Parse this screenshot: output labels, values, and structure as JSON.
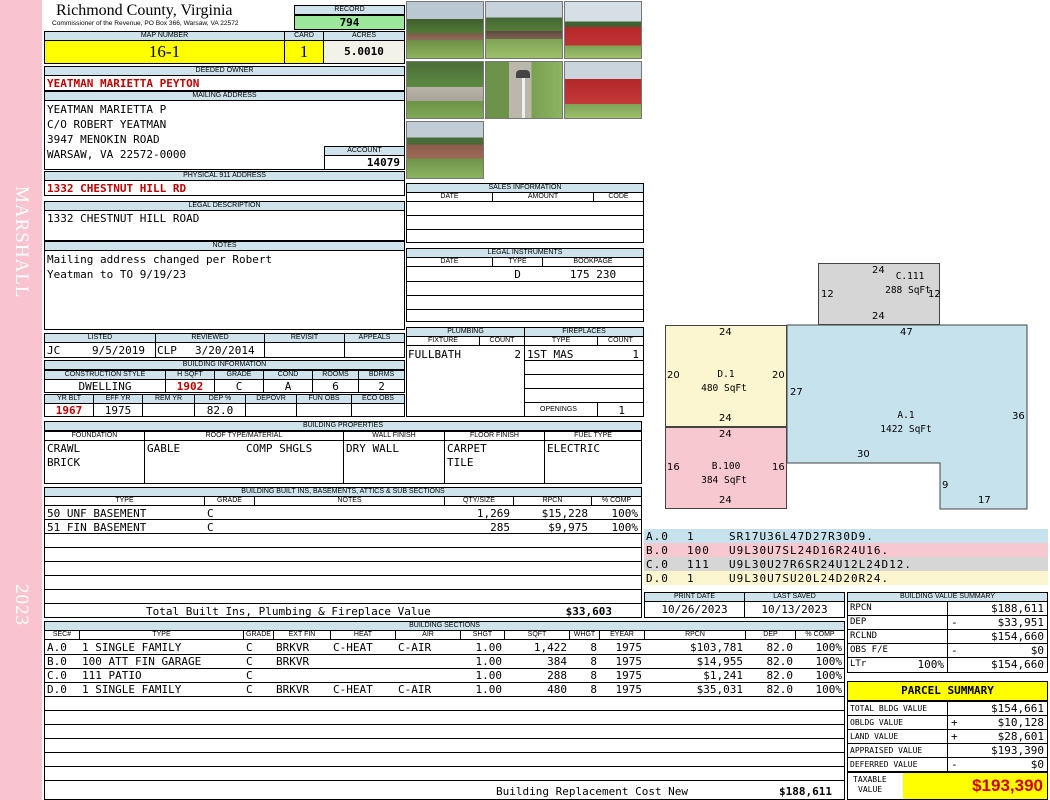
{
  "side": {
    "name": "MARSHALL",
    "year": "2023"
  },
  "header": {
    "county": "Richmond County, Virginia",
    "subtitle": "Commissioner of the Revenue, PO Box 366, Warsaw, VA 22572",
    "record_label": "RECORD",
    "record": "794",
    "map_label": "MAP NUMBER",
    "map": "16-1",
    "card_label": "CARD",
    "card": "1",
    "acres_label": "ACRES",
    "acres": "5.0010"
  },
  "owner": {
    "label": "DEEDED OWNER",
    "name": "YEATMAN MARIETTA PEYTON"
  },
  "mailing": {
    "label": "MAILING ADDRESS",
    "line1": "YEATMAN MARIETTA P",
    "line2": "C/O ROBERT YEATMAN",
    "line3": "3947 MENOKIN ROAD",
    "line4": "WARSAW, VA 22572-0000"
  },
  "account": {
    "label": "ACCOUNT",
    "value": "14079"
  },
  "physical": {
    "label": "PHYSICAL 911 ADDRESS",
    "value": "1332 CHESTNUT HILL RD"
  },
  "legal": {
    "label": "LEGAL DESCRIPTION",
    "value": "1332 CHESTNUT HILL ROAD"
  },
  "notes": {
    "label": "NOTES",
    "line1": "Mailing address changed per Robert",
    "line2": "Yeatman to TO 9/19/23"
  },
  "listed": {
    "listed_label": "LISTED",
    "reviewed_label": "REVIEWED",
    "revisit_label": "REVISIT",
    "appeals_label": "APPEALS",
    "listed_by": "JC",
    "listed_date": "9/5/2019",
    "reviewed_by": "CLP",
    "reviewed_date": "3/20/2014"
  },
  "building_info": {
    "label": "BUILDING INFORMATION",
    "h_style": "CONSTRUCTION STYLE",
    "h_hsqft": "H SQFT",
    "h_grade": "GRADE",
    "h_cond": "COND",
    "h_rooms": "ROOMS",
    "h_bdrms": "BDRMS",
    "style": "DWELLING",
    "hsqft": "1902",
    "grade": "C",
    "cond": "A",
    "rooms": "6",
    "bdrms": "2",
    "h_yrblt": "YR BLT",
    "h_effyr": "EFF YR",
    "h_remyr": "REM YR",
    "h_dep": "DEP %",
    "h_depovr": "DEPOVR",
    "h_funobs": "FUN OBS",
    "h_ecoobs": "ECO OBS",
    "yrblt": "1967",
    "effyr": "1975",
    "dep": "82.0"
  },
  "sales": {
    "label": "SALES INFORMATION",
    "h_date": "DATE",
    "h_amount": "AMOUNT",
    "h_code": "CODE"
  },
  "legal_instruments": {
    "label": "LEGAL INSTRUMENTS",
    "h_date": "DATE",
    "h_type": "TYPE",
    "h_book": "BOOKPAGE",
    "type": "D",
    "book": "175 230"
  },
  "plumbing": {
    "label": "PLUMBING",
    "h_fixture": "FIXTURE",
    "h_count": "COUNT",
    "fixture": "FULLBATH",
    "count": "2"
  },
  "fireplaces": {
    "label": "FIREPLACES",
    "h_type": "TYPE",
    "h_count": "COUNT",
    "type": "1ST MAS",
    "count": "1",
    "openings_label": "OPENINGS",
    "openings": "1"
  },
  "properties": {
    "label": "BUILDING PROPERTIES",
    "h_foundation": "FOUNDATION",
    "h_roof": "ROOF TYPE/MATERIAL",
    "h_wall": "WALL FINISH",
    "h_floor": "FLOOR FINISH",
    "h_fuel": "FUEL TYPE",
    "foundation1": "CRAWL",
    "foundation2": "BRICK",
    "roof_type": "GABLE",
    "roof_material": "COMP SHGLS",
    "wall": "DRY WALL",
    "floor1": "CARPET",
    "floor2": "TILE",
    "fuel": "ELECTRIC"
  },
  "builtins": {
    "label": "BUILDING BUILT INS, BASEMENTS, ATTICS & SUB SECTIONS",
    "h_type": "TYPE",
    "h_grade": "GRADE",
    "h_notes": "NOTES",
    "h_qty": "QTY/SIZE",
    "h_rpcn": "RPCN",
    "h_comp": "% COMP",
    "rows": [
      {
        "type": "50 UNF BASEMENT",
        "grade": "C",
        "qty": "1,269",
        "rpcn": "$15,228",
        "comp": "100%"
      },
      {
        "type": "51 FIN BASEMENT",
        "grade": "C",
        "qty": "285",
        "rpcn": "$9,975",
        "comp": "100%"
      }
    ],
    "total_label": "Total Built Ins, Plumbing & Fireplace Value",
    "total": "$33,603"
  },
  "sketch": {
    "c_label": "C.111",
    "c_area": "288 SqFt",
    "c_top": "24",
    "c_left": "12",
    "c_right": "12",
    "c_bottom": "24",
    "d_label": "D.1",
    "d_area": "480 SqFt",
    "d_top": "24",
    "d_left": "20",
    "d_right": "20",
    "d_bottom": "24",
    "a_label": "A.1",
    "a_area": "1422 SqFt",
    "a_top": "47",
    "a_left": "27",
    "a_right": "36",
    "a_step": "30",
    "a_notch": "9",
    "a_bottom": "17",
    "b_label": "B.100",
    "b_area": "384 SqFt",
    "b_top": "24",
    "b_left": "16",
    "b_right": "16",
    "b_bottom": "24"
  },
  "traces": [
    {
      "id": "A.0",
      "code": "1",
      "path": "SR17U36L47D27R30D9.",
      "color": "#c6e2ec"
    },
    {
      "id": "B.0",
      "code": "100",
      "path": "U9L30U7SL24D16R24U16.",
      "color": "#f7c8d0"
    },
    {
      "id": "C.0",
      "code": "111",
      "path": "U9L30U27R6SR24U12L24D12.",
      "color": "#d6d6d6"
    },
    {
      "id": "D.0",
      "code": "1",
      "path": "U9L30U7SU20L24D20R24.",
      "color": "#fbf5d0"
    }
  ],
  "dates": {
    "print_label": "PRINT DATE",
    "print": "10/26/2023",
    "saved_label": "LAST SAVED",
    "saved": "10/13/2023"
  },
  "sections": {
    "label": "BUILDING SECTIONS",
    "h_sec": "SEC#",
    "h_type": "TYPE",
    "h_grade": "GRADE",
    "h_ext": "EXT FIN",
    "h_heat": "HEAT",
    "h_air": "AIR",
    "h_shgt": "SHGT",
    "h_sqft": "SQFT",
    "h_whgt": "WHGT",
    "h_eyear": "EYEAR",
    "h_rpcn": "RPCN",
    "h_dep": "DEP",
    "h_comp": "% COMP",
    "rows": [
      {
        "sec": "A.0",
        "type": "1 SINGLE FAMILY",
        "grade": "C",
        "ext": "BRKVR",
        "heat": "C-HEAT",
        "air": "C-AIR",
        "shgt": "1.00",
        "sqft": "1,422",
        "whgt": "8",
        "eyear": "1975",
        "rpcn": "$103,781",
        "dep": "82.0",
        "comp": "100%"
      },
      {
        "sec": "B.0",
        "type": "100 ATT FIN GARAGE",
        "grade": "C",
        "ext": "BRKVR",
        "heat": "",
        "air": "",
        "shgt": "1.00",
        "sqft": "384",
        "whgt": "8",
        "eyear": "1975",
        "rpcn": "$14,955",
        "dep": "82.0",
        "comp": "100%"
      },
      {
        "sec": "C.0",
        "type": "111 PATIO",
        "grade": "C",
        "ext": "",
        "heat": "",
        "air": "",
        "shgt": "1.00",
        "sqft": "288",
        "whgt": "8",
        "eyear": "1975",
        "rpcn": "$1,241",
        "dep": "82.0",
        "comp": "100%"
      },
      {
        "sec": "D.0",
        "type": "1 SINGLE FAMILY",
        "grade": "C",
        "ext": "BRKVR",
        "heat": "C-HEAT",
        "air": "C-AIR",
        "shgt": "1.00",
        "sqft": "480",
        "whgt": "8",
        "eyear": "1975",
        "rpcn": "$35,031",
        "dep": "82.0",
        "comp": "100%"
      }
    ],
    "replacement_label": "Building Replacement Cost New",
    "replacement": "$188,611"
  },
  "value_summary": {
    "label": "BUILDING VALUE SUMMARY",
    "rpcn_label": "RPCN",
    "rpcn": "$188,611",
    "dep_label": "DEP",
    "dep_sign": "-",
    "dep": "$33,951",
    "rclnd_label": "RCLND",
    "rclnd": "$154,660",
    "obs_label": "OBS F/E",
    "obs_sign": "-",
    "obs": "$0",
    "ltr_label": "LTr",
    "ltr_pct": "100%",
    "ltr": "$154,660"
  },
  "parcel": {
    "label": "PARCEL SUMMARY",
    "bldg_label": "TOTAL BLDG VALUE",
    "bldg": "$154,661",
    "obldg_label": "OBLDG VALUE",
    "obldg_sign": "+",
    "obldg": "$10,128",
    "land_label": "LAND VALUE",
    "land_sign": "+",
    "land": "$28,601",
    "appraised_label": "APPRAISED VALUE",
    "appraised": "$193,390",
    "deferred_label": "DEFERRED VALUE",
    "deferred_sign": "-",
    "deferred": "$0",
    "taxable_label1": "TAXABLE",
    "taxable_label2": "VALUE",
    "taxable": "$193,390"
  },
  "photos": [
    "house-photo",
    "house-photo",
    "barn-photo",
    "driveway-photo",
    "mailbox-photo",
    "barn-photo",
    "house-photo"
  ]
}
